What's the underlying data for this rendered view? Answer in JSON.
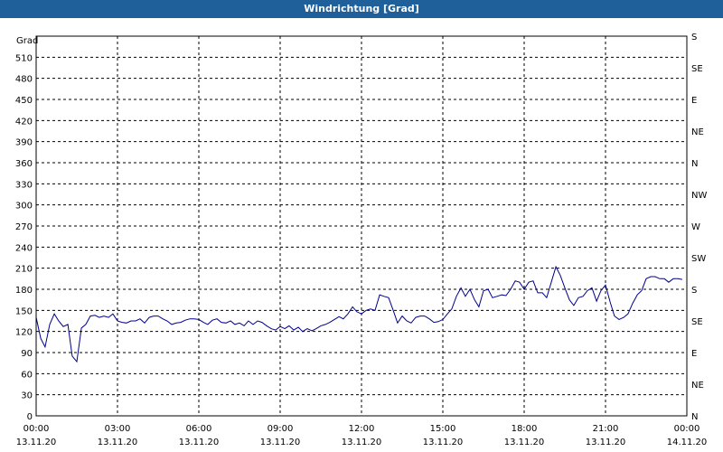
{
  "window": {
    "title": "Windrichtung [Grad]"
  },
  "chart_data": {
    "type": "line",
    "title": "Windrichtung [Grad]",
    "ylabel": "Grad",
    "xlabel": "",
    "ylim": [
      0,
      540
    ],
    "xlim": [
      0,
      24
    ],
    "grid": true,
    "y_ticks": [
      0,
      30,
      60,
      90,
      120,
      150,
      180,
      210,
      240,
      270,
      300,
      330,
      360,
      390,
      420,
      450,
      480,
      510
    ],
    "y_right_labels": [
      {
        "v": 0,
        "label": "N"
      },
      {
        "v": 45,
        "label": "NE"
      },
      {
        "v": 90,
        "label": "E"
      },
      {
        "v": 135,
        "label": "SE"
      },
      {
        "v": 180,
        "label": "S"
      },
      {
        "v": 225,
        "label": "SW"
      },
      {
        "v": 270,
        "label": "W"
      },
      {
        "v": 315,
        "label": "NW"
      },
      {
        "v": 360,
        "label": "N"
      },
      {
        "v": 405,
        "label": "NE"
      },
      {
        "v": 450,
        "label": "E"
      },
      {
        "v": 495,
        "label": "SE"
      },
      {
        "v": 540,
        "label": "S"
      }
    ],
    "x_ticks": [
      {
        "h": 0,
        "time": "00:00",
        "date": "13.11.20"
      },
      {
        "h": 3,
        "time": "03:00",
        "date": "13.11.20"
      },
      {
        "h": 6,
        "time": "06:00",
        "date": "13.11.20"
      },
      {
        "h": 9,
        "time": "09:00",
        "date": "13.11.20"
      },
      {
        "h": 12,
        "time": "12:00",
        "date": "13.11.20"
      },
      {
        "h": 15,
        "time": "15:00",
        "date": "13.11.20"
      },
      {
        "h": 18,
        "time": "18:00",
        "date": "13.11.20"
      },
      {
        "h": 21,
        "time": "21:00",
        "date": "13.11.20"
      },
      {
        "h": 24,
        "time": "00:00",
        "date": "14.11.20"
      }
    ],
    "series": [
      {
        "color": "#00008b",
        "points": [
          [
            0.0,
            140
          ],
          [
            0.17,
            110
          ],
          [
            0.33,
            98
          ],
          [
            0.5,
            130
          ],
          [
            0.67,
            145
          ],
          [
            0.83,
            135
          ],
          [
            1.0,
            127
          ],
          [
            1.17,
            130
          ],
          [
            1.33,
            85
          ],
          [
            1.5,
            77
          ],
          [
            1.67,
            125
          ],
          [
            1.83,
            130
          ],
          [
            2.0,
            142
          ],
          [
            2.17,
            143
          ],
          [
            2.33,
            140
          ],
          [
            2.5,
            142
          ],
          [
            2.67,
            140
          ],
          [
            2.83,
            145
          ],
          [
            3.0,
            135
          ],
          [
            3.17,
            133
          ],
          [
            3.33,
            132
          ],
          [
            3.5,
            135
          ],
          [
            3.67,
            135
          ],
          [
            3.83,
            138
          ],
          [
            4.0,
            132
          ],
          [
            4.17,
            140
          ],
          [
            4.33,
            142
          ],
          [
            4.5,
            142
          ],
          [
            4.67,
            138
          ],
          [
            4.83,
            135
          ],
          [
            5.0,
            130
          ],
          [
            5.17,
            132
          ],
          [
            5.33,
            133
          ],
          [
            5.5,
            136
          ],
          [
            5.67,
            138
          ],
          [
            5.83,
            138
          ],
          [
            6.0,
            137
          ],
          [
            6.17,
            133
          ],
          [
            6.33,
            130
          ],
          [
            6.5,
            136
          ],
          [
            6.67,
            138
          ],
          [
            6.83,
            133
          ],
          [
            7.0,
            132
          ],
          [
            7.17,
            135
          ],
          [
            7.33,
            130
          ],
          [
            7.5,
            132
          ],
          [
            7.67,
            128
          ],
          [
            7.83,
            135
          ],
          [
            8.0,
            130
          ],
          [
            8.17,
            135
          ],
          [
            8.33,
            133
          ],
          [
            8.5,
            128
          ],
          [
            8.67,
            124
          ],
          [
            8.83,
            122
          ],
          [
            9.0,
            127
          ],
          [
            9.17,
            124
          ],
          [
            9.33,
            128
          ],
          [
            9.5,
            122
          ],
          [
            9.67,
            126
          ],
          [
            9.83,
            120
          ],
          [
            10.0,
            124
          ],
          [
            10.17,
            121
          ],
          [
            10.33,
            124
          ],
          [
            10.5,
            128
          ],
          [
            10.67,
            130
          ],
          [
            10.83,
            133
          ],
          [
            11.0,
            137
          ],
          [
            11.17,
            141
          ],
          [
            11.33,
            138
          ],
          [
            11.5,
            145
          ],
          [
            11.67,
            155
          ],
          [
            11.83,
            148
          ],
          [
            12.0,
            145
          ],
          [
            12.17,
            150
          ],
          [
            12.33,
            152
          ],
          [
            12.5,
            150
          ],
          [
            12.67,
            172
          ],
          [
            12.83,
            170
          ],
          [
            13.0,
            168
          ],
          [
            13.17,
            150
          ],
          [
            13.33,
            132
          ],
          [
            13.5,
            142
          ],
          [
            13.67,
            135
          ],
          [
            13.83,
            132
          ],
          [
            14.0,
            140
          ],
          [
            14.17,
            142
          ],
          [
            14.33,
            142
          ],
          [
            14.5,
            138
          ],
          [
            14.67,
            133
          ],
          [
            14.83,
            134
          ],
          [
            15.0,
            137
          ],
          [
            15.17,
            145
          ],
          [
            15.33,
            152
          ],
          [
            15.5,
            170
          ],
          [
            15.67,
            182
          ],
          [
            15.83,
            170
          ],
          [
            16.0,
            180
          ],
          [
            16.17,
            165
          ],
          [
            16.33,
            155
          ],
          [
            16.5,
            178
          ],
          [
            16.67,
            180
          ],
          [
            16.83,
            168
          ],
          [
            17.0,
            170
          ],
          [
            17.17,
            172
          ],
          [
            17.33,
            171
          ],
          [
            17.5,
            180
          ],
          [
            17.67,
            192
          ],
          [
            17.83,
            190
          ],
          [
            18.0,
            180
          ],
          [
            18.17,
            190
          ],
          [
            18.33,
            192
          ],
          [
            18.5,
            175
          ],
          [
            18.67,
            175
          ],
          [
            18.83,
            168
          ],
          [
            19.0,
            190
          ],
          [
            19.17,
            212
          ],
          [
            19.33,
            200
          ],
          [
            19.5,
            182
          ],
          [
            19.67,
            165
          ],
          [
            19.83,
            157
          ],
          [
            20.0,
            168
          ],
          [
            20.17,
            170
          ],
          [
            20.33,
            178
          ],
          [
            20.5,
            182
          ],
          [
            20.67,
            163
          ],
          [
            20.83,
            178
          ],
          [
            21.0,
            186
          ],
          [
            21.17,
            162
          ],
          [
            21.33,
            142
          ],
          [
            21.5,
            137
          ],
          [
            21.67,
            140
          ],
          [
            21.83,
            145
          ],
          [
            22.0,
            160
          ],
          [
            22.17,
            172
          ],
          [
            22.33,
            178
          ],
          [
            22.5,
            195
          ],
          [
            22.67,
            198
          ],
          [
            22.83,
            198
          ],
          [
            23.0,
            195
          ],
          [
            23.17,
            195
          ],
          [
            23.33,
            190
          ],
          [
            23.5,
            195
          ],
          [
            23.67,
            195
          ],
          [
            23.83,
            194
          ]
        ]
      }
    ]
  }
}
